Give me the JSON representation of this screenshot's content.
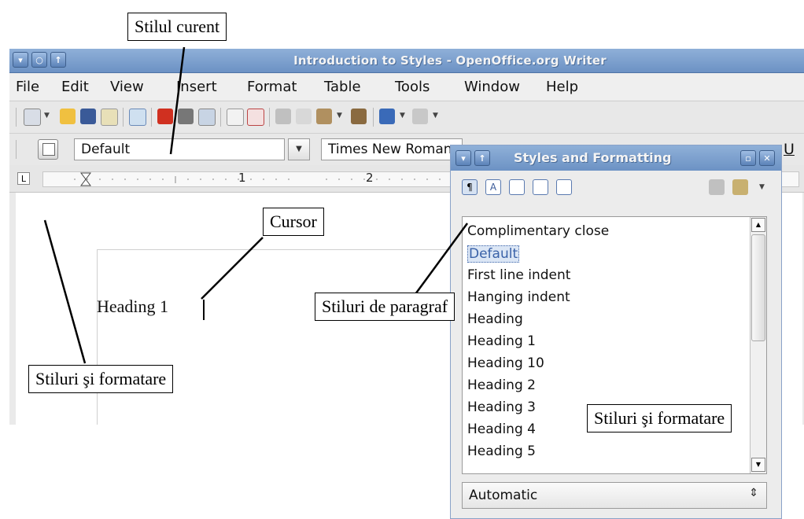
{
  "window": {
    "title": "Introduction to Styles - OpenOffice.org Writer"
  },
  "menu": [
    "File",
    "Edit",
    "View",
    "Insert",
    "Format",
    "Table",
    "Tools",
    "Window",
    "Help"
  ],
  "formatting_toolbar": {
    "style_value": "Default",
    "font_value": "Times New Roman",
    "underline_label": "U"
  },
  "ruler": {
    "label_1": "1",
    "label_2": "2"
  },
  "document": {
    "text": "Heading 1"
  },
  "styles_dialog": {
    "title": "Styles and Formatting",
    "items": [
      "Complimentary close",
      "Default",
      "First line indent",
      "Hanging indent",
      "Heading",
      "Heading 1",
      "Heading 10",
      "Heading 2",
      "Heading 3",
      "Heading 4",
      "Heading 5"
    ],
    "selected": "Default",
    "filter_value": "Automatic"
  },
  "callouts": {
    "current_style": "Stilul curent",
    "cursor": "Cursor",
    "paragraph_styles": "Stiluri de paragraf",
    "styles_formatting_left": "Stiluri şi formatare",
    "styles_formatting_right": "Stiluri şi formatare"
  },
  "colors": {
    "title_bar": "#7a9ccc",
    "selection": "#4a72b0"
  }
}
